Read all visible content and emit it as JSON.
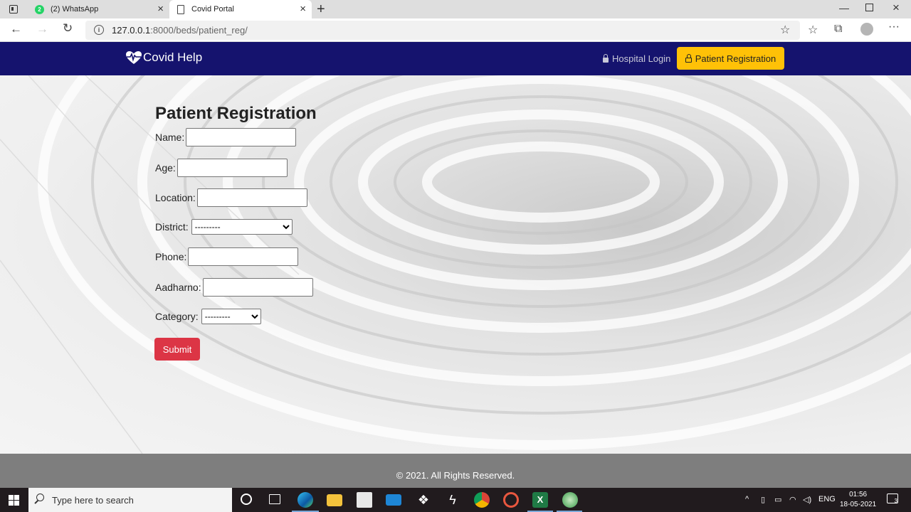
{
  "browser": {
    "tabs": [
      {
        "label": "(2) WhatsApp",
        "badge": "2"
      },
      {
        "label": "Covid Portal"
      }
    ],
    "url_host": "127.0.0.1",
    "url_path": ":8000/beds/patient_reg/"
  },
  "navbar": {
    "brand": "Covid Help",
    "hospital_login": "Hospital Login",
    "patient_registration": "Patient Registration"
  },
  "form": {
    "title": "Patient Registration",
    "fields": {
      "name": "Name:",
      "age": "Age:",
      "location": "Location:",
      "district": "District:",
      "phone": "Phone:",
      "aadharno": "Aadharno:",
      "category": "Category:"
    },
    "district_selected": "---------",
    "category_selected": "---------",
    "submit": "Submit"
  },
  "footer": {
    "text": "© 2021. All Rights Reserved."
  },
  "taskbar": {
    "search_placeholder": "Type here to search",
    "lang": "ENG",
    "time": "01:56",
    "date": "18-05-2021",
    "notification_count": "3"
  },
  "colors": {
    "navbar": "#15136e",
    "registration_button": "#ffc107",
    "submit_button": "#dc3545",
    "footer": "#7e7e7e"
  }
}
